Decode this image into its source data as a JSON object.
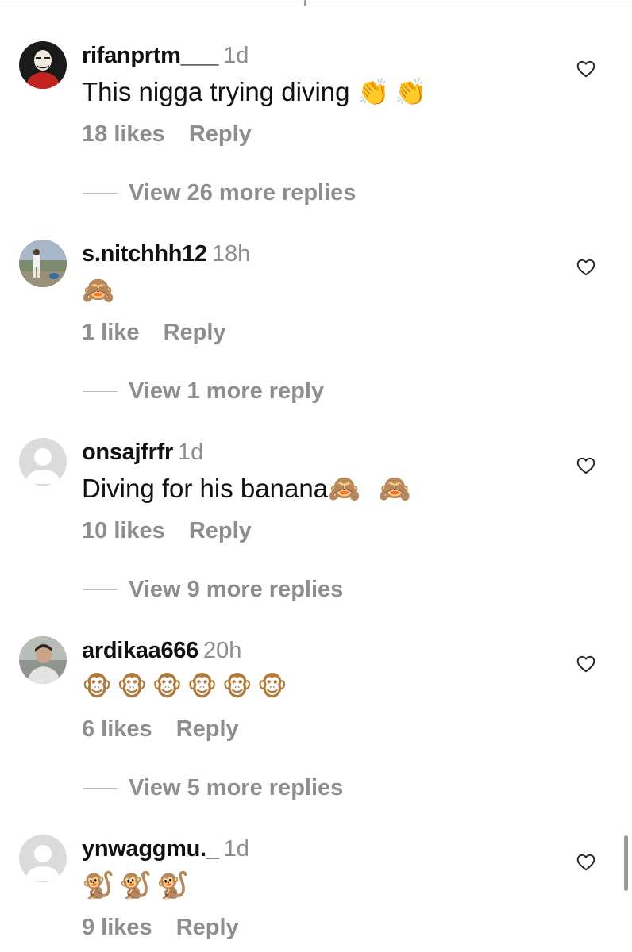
{
  "comments": [
    {
      "username": "rifanprtm___",
      "time": "1d",
      "text": "This nigga trying diving",
      "emoji": "👏👏",
      "likes": "18 likes",
      "reply": "Reply",
      "view_replies": "View 26 more replies",
      "avatar": "masked-person-red-shirt"
    },
    {
      "username": "s.nitchhh12",
      "time": "18h",
      "text": "",
      "emoji": "🙈",
      "likes": "1 like",
      "reply": "Reply",
      "view_replies": "View 1 more reply",
      "avatar": "person-standing-outdoors"
    },
    {
      "username": "onsajfrfr",
      "time": "1d",
      "text": "Diving for his banana",
      "emoji": "🙈 🙈",
      "likes": "10 likes",
      "reply": "Reply",
      "view_replies": "View 9 more replies",
      "avatar": "default-silhouette"
    },
    {
      "username": "ardikaa666",
      "time": "20h",
      "text": "",
      "emoji": "🐵🐵🐵🐵🐵🐵",
      "likes": "6 likes",
      "reply": "Reply",
      "view_replies": "View 5 more replies",
      "avatar": "person-photo"
    },
    {
      "username": "ynwaggmu._",
      "time": "1d",
      "text": "",
      "emoji": "🐒🐒🐒",
      "likes": "9 likes",
      "reply": "Reply",
      "view_replies": "",
      "avatar": "default-silhouette"
    }
  ],
  "icons": {
    "like": "heart-outline-icon"
  },
  "colors": {
    "primary_text": "#111111",
    "secondary_text": "#8e8e8e",
    "background": "#ffffff"
  }
}
